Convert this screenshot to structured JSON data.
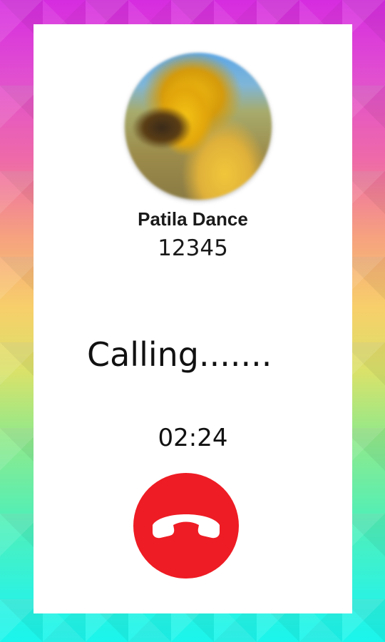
{
  "call": {
    "caller_name": "Patila Dance",
    "caller_number": "12345",
    "status": "Calling.......",
    "duration": "02:24"
  },
  "controls": {
    "end_call_icon": "phone-hangup-icon",
    "end_call_color": "#ee1c24"
  },
  "theme": {
    "card_background": "#ffffff"
  }
}
